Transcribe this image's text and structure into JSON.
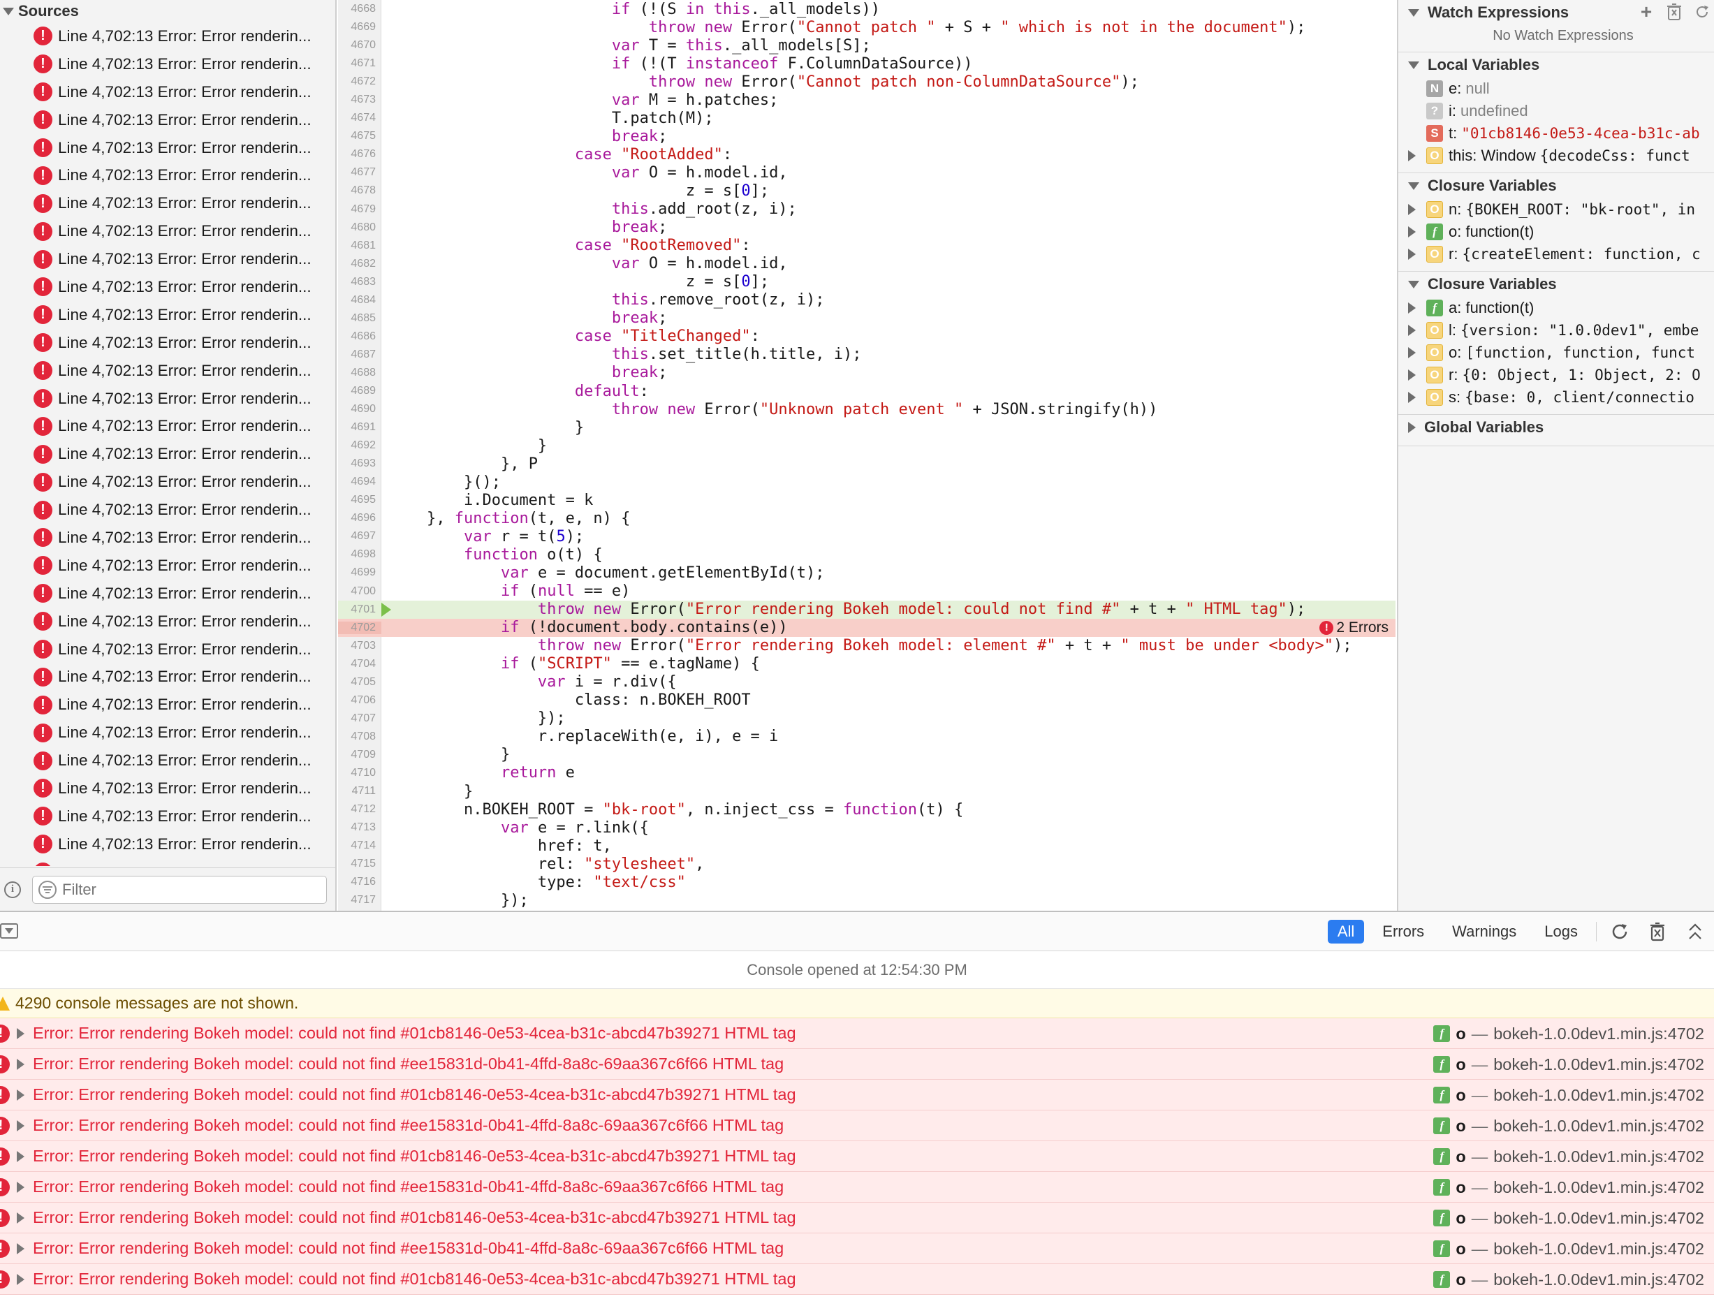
{
  "sources": {
    "title": "Sources",
    "item_label": "Line 4,702:13 Error: Error renderin...",
    "item_count": 31,
    "filter_placeholder": "Filter"
  },
  "editor": {
    "lines": [
      {
        "n": "4668",
        "i": 12,
        "t": [
          [
            "kw",
            "if"
          ],
          [
            "p",
            " (!(S "
          ],
          [
            "kw",
            "in"
          ],
          [
            "p",
            " "
          ],
          [
            "kw",
            "this"
          ],
          [
            "p",
            "._all_models))"
          ]
        ]
      },
      {
        "n": "4669",
        "i": 14,
        "t": [
          [
            "kw",
            "throw new"
          ],
          [
            "p",
            " Error("
          ],
          [
            "str",
            "\"Cannot patch \""
          ],
          [
            "p",
            " + S + "
          ],
          [
            "str",
            "\" which is not in the document\""
          ],
          [
            "p",
            ");"
          ]
        ]
      },
      {
        "n": "4670",
        "i": 12,
        "t": [
          [
            "kw",
            "var"
          ],
          [
            "p",
            " T = "
          ],
          [
            "kw",
            "this"
          ],
          [
            "p",
            "._all_models[S];"
          ]
        ]
      },
      {
        "n": "4671",
        "i": 12,
        "t": [
          [
            "kw",
            "if"
          ],
          [
            "p",
            " (!(T "
          ],
          [
            "kw",
            "instanceof"
          ],
          [
            "p",
            " F.ColumnDataSource))"
          ]
        ]
      },
      {
        "n": "4672",
        "i": 14,
        "t": [
          [
            "kw",
            "throw new"
          ],
          [
            "p",
            " Error("
          ],
          [
            "str",
            "\"Cannot patch non-ColumnDataSource\""
          ],
          [
            "p",
            ");"
          ]
        ]
      },
      {
        "n": "4673",
        "i": 12,
        "t": [
          [
            "kw",
            "var"
          ],
          [
            "p",
            " M = h.patches;"
          ]
        ]
      },
      {
        "n": "4674",
        "i": 12,
        "t": [
          [
            "p",
            "T.patch(M);"
          ]
        ]
      },
      {
        "n": "4675",
        "i": 12,
        "t": [
          [
            "kw",
            "break"
          ],
          [
            "p",
            ";"
          ]
        ]
      },
      {
        "n": "4676",
        "i": 10,
        "t": [
          [
            "kw",
            "case"
          ],
          [
            "p",
            " "
          ],
          [
            "str",
            "\"RootAdded\""
          ],
          [
            "p",
            ":"
          ]
        ]
      },
      {
        "n": "4677",
        "i": 12,
        "t": [
          [
            "kw",
            "var"
          ],
          [
            "p",
            " O = h.model.id,"
          ]
        ]
      },
      {
        "n": "4678",
        "i": 16,
        "t": [
          [
            "p",
            "z = s["
          ],
          [
            "num",
            "0"
          ],
          [
            "p",
            "];"
          ]
        ]
      },
      {
        "n": "4679",
        "i": 12,
        "t": [
          [
            "kw",
            "this"
          ],
          [
            "p",
            ".add_root(z, i);"
          ]
        ]
      },
      {
        "n": "4680",
        "i": 12,
        "t": [
          [
            "kw",
            "break"
          ],
          [
            "p",
            ";"
          ]
        ]
      },
      {
        "n": "4681",
        "i": 10,
        "t": [
          [
            "kw",
            "case"
          ],
          [
            "p",
            " "
          ],
          [
            "str",
            "\"RootRemoved\""
          ],
          [
            "p",
            ":"
          ]
        ]
      },
      {
        "n": "4682",
        "i": 12,
        "t": [
          [
            "kw",
            "var"
          ],
          [
            "p",
            " O = h.model.id,"
          ]
        ]
      },
      {
        "n": "4683",
        "i": 16,
        "t": [
          [
            "p",
            "z = s["
          ],
          [
            "num",
            "0"
          ],
          [
            "p",
            "];"
          ]
        ]
      },
      {
        "n": "4684",
        "i": 12,
        "t": [
          [
            "kw",
            "this"
          ],
          [
            "p",
            ".remove_root(z, i);"
          ]
        ]
      },
      {
        "n": "4685",
        "i": 12,
        "t": [
          [
            "kw",
            "break"
          ],
          [
            "p",
            ";"
          ]
        ]
      },
      {
        "n": "4686",
        "i": 10,
        "t": [
          [
            "kw",
            "case"
          ],
          [
            "p",
            " "
          ],
          [
            "str",
            "\"TitleChanged\""
          ],
          [
            "p",
            ":"
          ]
        ]
      },
      {
        "n": "4687",
        "i": 12,
        "t": [
          [
            "kw",
            "this"
          ],
          [
            "p",
            ".set_title(h.title, i);"
          ]
        ]
      },
      {
        "n": "4688",
        "i": 12,
        "t": [
          [
            "kw",
            "break"
          ],
          [
            "p",
            ";"
          ]
        ]
      },
      {
        "n": "4689",
        "i": 10,
        "t": [
          [
            "kw",
            "default"
          ],
          [
            "p",
            ":"
          ]
        ]
      },
      {
        "n": "4690",
        "i": 12,
        "t": [
          [
            "kw",
            "throw new"
          ],
          [
            "p",
            " Error("
          ],
          [
            "str",
            "\"Unknown patch event \""
          ],
          [
            "p",
            " + JSON.stringify(h))"
          ]
        ]
      },
      {
        "n": "4691",
        "i": 10,
        "t": [
          [
            "p",
            "}"
          ]
        ]
      },
      {
        "n": "4692",
        "i": 8,
        "t": [
          [
            "p",
            "}"
          ]
        ]
      },
      {
        "n": "4693",
        "i": 6,
        "t": [
          [
            "p",
            "}, P"
          ]
        ]
      },
      {
        "n": "4694",
        "i": 4,
        "t": [
          [
            "p",
            "}();"
          ]
        ]
      },
      {
        "n": "4695",
        "i": 4,
        "t": [
          [
            "p",
            "i.Document = k"
          ]
        ]
      },
      {
        "n": "4696",
        "i": 2,
        "t": [
          [
            "p",
            "}, "
          ],
          [
            "kw",
            "function"
          ],
          [
            "p",
            "(t, e, n) {"
          ]
        ]
      },
      {
        "n": "4697",
        "i": 4,
        "t": [
          [
            "kw",
            "var"
          ],
          [
            "p",
            " r = t("
          ],
          [
            "num",
            "5"
          ],
          [
            "p",
            ");"
          ]
        ]
      },
      {
        "n": "4698",
        "i": 4,
        "t": [
          [
            "kw",
            "function"
          ],
          [
            "p",
            " o(t) {"
          ]
        ]
      },
      {
        "n": "4699",
        "i": 6,
        "t": [
          [
            "kw",
            "var"
          ],
          [
            "p",
            " e = document.getElementById(t);"
          ]
        ]
      },
      {
        "n": "4700",
        "i": 6,
        "t": [
          [
            "kw",
            "if"
          ],
          [
            "p",
            " ("
          ],
          [
            "kw",
            "null"
          ],
          [
            "p",
            " == e)"
          ]
        ]
      },
      {
        "n": "4701",
        "i": 8,
        "hl": "green",
        "t": [
          [
            "kw",
            "throw new"
          ],
          [
            "p",
            " Error("
          ],
          [
            "str",
            "\"Error rendering Bokeh model: could not find #\""
          ],
          [
            "p",
            " + t + "
          ],
          [
            "str",
            "\" HTML tag\""
          ],
          [
            "p",
            ");"
          ]
        ]
      },
      {
        "n": "4702",
        "i": 6,
        "hl": "red",
        "t": [
          [
            "kw",
            "if"
          ],
          [
            "p",
            " (!document.body.contains(e))"
          ]
        ]
      },
      {
        "n": "4703",
        "i": 8,
        "t": [
          [
            "kw",
            "throw new"
          ],
          [
            "p",
            " Error("
          ],
          [
            "str",
            "\"Error rendering Bokeh model: element #\""
          ],
          [
            "p",
            " + t + "
          ],
          [
            "str",
            "\" must be under <body>\""
          ],
          [
            "p",
            ");"
          ]
        ]
      },
      {
        "n": "4704",
        "i": 6,
        "t": [
          [
            "kw",
            "if"
          ],
          [
            "p",
            " ("
          ],
          [
            "str",
            "\"SCRIPT\""
          ],
          [
            "p",
            " == e.tagName) {"
          ]
        ]
      },
      {
        "n": "4705",
        "i": 8,
        "t": [
          [
            "kw",
            "var"
          ],
          [
            "p",
            " i = r.div({"
          ]
        ]
      },
      {
        "n": "4706",
        "i": 10,
        "t": [
          [
            "p",
            "class: n.BOKEH_ROOT"
          ]
        ]
      },
      {
        "n": "4707",
        "i": 8,
        "t": [
          [
            "p",
            "});"
          ]
        ]
      },
      {
        "n": "4708",
        "i": 8,
        "t": [
          [
            "p",
            "r.replaceWith(e, i), e = i"
          ]
        ]
      },
      {
        "n": "4709",
        "i": 6,
        "t": [
          [
            "p",
            "}"
          ]
        ]
      },
      {
        "n": "4710",
        "i": 6,
        "t": [
          [
            "kw",
            "return"
          ],
          [
            "p",
            " e"
          ]
        ]
      },
      {
        "n": "4711",
        "i": 4,
        "t": [
          [
            "p",
            "}"
          ]
        ]
      },
      {
        "n": "4712",
        "i": 4,
        "t": [
          [
            "p",
            "n.BOKEH_ROOT = "
          ],
          [
            "str",
            "\"bk-root\""
          ],
          [
            "p",
            ", n.inject_css = "
          ],
          [
            "kw",
            "function"
          ],
          [
            "p",
            "(t) {"
          ]
        ]
      },
      {
        "n": "4713",
        "i": 6,
        "t": [
          [
            "kw",
            "var"
          ],
          [
            "p",
            " e = r.link({"
          ]
        ]
      },
      {
        "n": "4714",
        "i": 8,
        "t": [
          [
            "p",
            "href: t,"
          ]
        ]
      },
      {
        "n": "4715",
        "i": 8,
        "t": [
          [
            "p",
            "rel: "
          ],
          [
            "str",
            "\"stylesheet\""
          ],
          [
            "p",
            ","
          ]
        ]
      },
      {
        "n": "4716",
        "i": 8,
        "t": [
          [
            "p",
            "type: "
          ],
          [
            "str",
            "\"text/css\""
          ]
        ]
      },
      {
        "n": "4717",
        "i": 6,
        "t": [
          [
            "p",
            "});"
          ]
        ]
      }
    ],
    "error_badge": "2 Errors"
  },
  "debugger": {
    "watch": {
      "title": "Watch Expressions",
      "empty": "No Watch Expressions"
    },
    "local": {
      "title": "Local Variables",
      "vars": [
        {
          "badge": "N",
          "expand": false,
          "name": "e:",
          "value": "null",
          "style": "gray"
        },
        {
          "badge": "?",
          "expand": false,
          "name": "i:",
          "value": "undefined",
          "style": "gray"
        },
        {
          "badge": "S",
          "expand": false,
          "name": "t:",
          "value": "\"01cb8146-0e53-4cea-b31c-ab",
          "style": "red"
        },
        {
          "badge": "O",
          "expand": true,
          "name": "this: Window",
          "value": "{decodeCss: funct",
          "style": "dark"
        }
      ]
    },
    "closure1": {
      "title": "Closure Variables",
      "vars": [
        {
          "badge": "O",
          "expand": true,
          "name": "n:",
          "value": "{BOKEH_ROOT: \"bk-root\", in",
          "style": "dark"
        },
        {
          "badge": "F",
          "expand": true,
          "name": "o: function(t)",
          "value": "",
          "style": "dark"
        },
        {
          "badge": "O",
          "expand": true,
          "name": "r:",
          "value": "{createElement: function, c",
          "style": "dark"
        }
      ]
    },
    "closure2": {
      "title": "Closure Variables",
      "vars": [
        {
          "badge": "F",
          "expand": true,
          "name": "a: function(t)",
          "value": "",
          "style": "dark"
        },
        {
          "badge": "O",
          "expand": true,
          "name": "l:",
          "value": "{version: \"1.0.0dev1\", embe",
          "style": "dark"
        },
        {
          "badge": "O",
          "expand": true,
          "name": "o:",
          "value": "[function, function, funct",
          "style": "dark"
        },
        {
          "badge": "O",
          "expand": true,
          "name": "r:",
          "value": "{0: Object, 1: Object, 2: O",
          "style": "dark"
        },
        {
          "badge": "O",
          "expand": true,
          "name": "s:",
          "value": "{base: 0, client/connectio",
          "style": "dark"
        }
      ]
    },
    "global": {
      "title": "Global Variables"
    }
  },
  "console": {
    "filters": [
      "All",
      "Errors",
      "Warnings",
      "Logs"
    ],
    "active_filter": "All",
    "opened_at": "Console opened at 12:54:30 PM",
    "hidden_warning": "4290 console messages are not shown.",
    "messages": [
      {
        "text": "Error: Error rendering Bokeh model: could not find #01cb8146-0e53-4cea-b31c-abcd47b39271 HTML tag"
      },
      {
        "text": "Error: Error rendering Bokeh model: could not find #ee15831d-0b41-4ffd-8a8c-69aa367c6f66 HTML tag"
      },
      {
        "text": "Error: Error rendering Bokeh model: could not find #01cb8146-0e53-4cea-b31c-abcd47b39271 HTML tag"
      },
      {
        "text": "Error: Error rendering Bokeh model: could not find #ee15831d-0b41-4ffd-8a8c-69aa367c6f66 HTML tag"
      },
      {
        "text": "Error: Error rendering Bokeh model: could not find #01cb8146-0e53-4cea-b31c-abcd47b39271 HTML tag"
      },
      {
        "text": "Error: Error rendering Bokeh model: could not find #ee15831d-0b41-4ffd-8a8c-69aa367c6f66 HTML tag"
      },
      {
        "text": "Error: Error rendering Bokeh model: could not find #01cb8146-0e53-4cea-b31c-abcd47b39271 HTML tag"
      },
      {
        "text": "Error: Error rendering Bokeh model: could not find #ee15831d-0b41-4ffd-8a8c-69aa367c6f66 HTML tag"
      },
      {
        "text": "Error: Error rendering Bokeh model: could not find #01cb8146-0e53-4cea-b31c-abcd47b39271 HTML tag"
      }
    ],
    "message_function": "o",
    "message_source": "bokeh-1.0.0dev1.min.js:4702"
  },
  "colors": {
    "error": "#e2253a",
    "accent": "#2b7cf0",
    "keyword": "#a8199b",
    "string": "#c41a16"
  },
  "icons": [
    "error-icon",
    "filter-icon",
    "info-icon",
    "add-icon",
    "trash-icon",
    "refresh-icon",
    "clear-console-icon",
    "reload-icon",
    "expand-icon",
    "warning-icon",
    "function-icon"
  ]
}
